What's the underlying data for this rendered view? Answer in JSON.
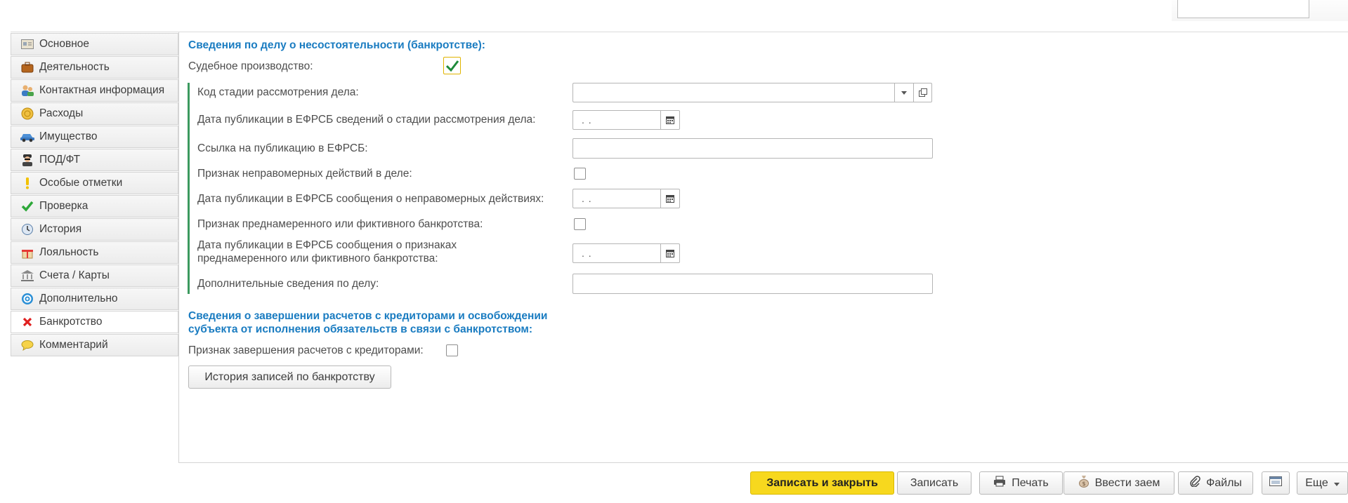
{
  "sidebar": {
    "items": [
      {
        "label": "Основное",
        "icon": "basic-info-icon"
      },
      {
        "label": "Деятельность",
        "icon": "briefcase-icon"
      },
      {
        "label": "Контактная информация",
        "icon": "contacts-icon"
      },
      {
        "label": "Расходы",
        "icon": "coins-icon"
      },
      {
        "label": "Имущество",
        "icon": "car-icon"
      },
      {
        "label": "ПОД/ФТ",
        "icon": "agent-icon"
      },
      {
        "label": "Особые отметки",
        "icon": "exclamation-icon"
      },
      {
        "label": "Проверка",
        "icon": "check-icon"
      },
      {
        "label": "История",
        "icon": "clock-icon"
      },
      {
        "label": "Лояльность",
        "icon": "gift-icon"
      },
      {
        "label": "Счета / Карты",
        "icon": "bank-icon"
      },
      {
        "label": "Дополнительно",
        "icon": "gear-icon"
      },
      {
        "label": "Банкротство",
        "icon": "cross-icon"
      },
      {
        "label": "Комментарий",
        "icon": "comment-icon"
      }
    ],
    "active_index": 12
  },
  "bankruptcy": {
    "title": "Сведения по делу о несостоятельности (банкротстве):",
    "court_label": "Судебное производство:",
    "court_checked": true,
    "stage_code_label": "Код стадии рассмотрения дела:",
    "stage_code_value": "",
    "stage_pub_date_label": "Дата публикации в ЕФРСБ  сведений о стадии рассмотрения дела:",
    "stage_pub_date_value": ".  .",
    "link_label": "Ссылка на публикацию в ЕФРСБ:",
    "link_value": "",
    "illegal_label": "Признак неправомерных действий в деле:",
    "illegal_pub_date_label": "Дата публикации в ЕФРСБ сообщения о неправомерных действиях:",
    "illegal_pub_date_value": ".  .",
    "fictitious_label": "Признак преднамеренного или фиктивного банкротства:",
    "fictitious_pub_date_label_1": "Дата публикации в ЕФРСБ сообщения о признаках",
    "fictitious_pub_date_label_2": "преднамеренного или фиктивного банкротства:",
    "fictitious_pub_date_value": ".  .",
    "additional_label": "Дополнительные сведения по делу:",
    "additional_value": ""
  },
  "completion": {
    "title_1": "Сведения о завершении расчетов с кредиторами и освобождении",
    "title_2": "субъекта от исполнения обязательств в связи с банкротством:",
    "settlement_label": "Признак завершения расчетов с кредиторами:",
    "history_button": "История записей по банкротству"
  },
  "toolbar": {
    "save_close": "Записать и закрыть",
    "save": "Записать",
    "print": "Печать",
    "loan": "Ввести заем",
    "files": "Файлы",
    "more": "Еще"
  },
  "colors": {
    "accent_title": "#1a7cc1",
    "primary_button": "#f7d81e",
    "group_bar": "#3c9a5f"
  }
}
